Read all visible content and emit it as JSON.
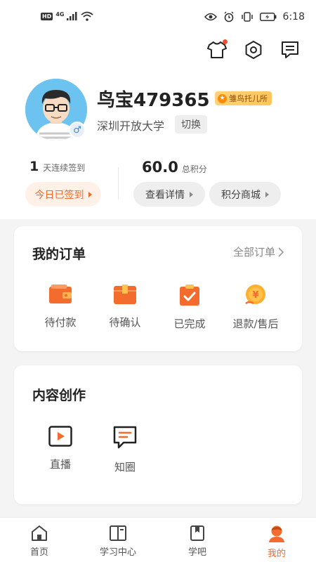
{
  "status_bar": {
    "network_badge": "HD",
    "network_type": "4G",
    "time": "6:18",
    "icons": [
      "signal-icon",
      "wifi-icon",
      "eye-icon",
      "alarm-icon",
      "vibrate-icon",
      "battery-icon"
    ]
  },
  "header": {
    "icons": [
      "shirt-icon",
      "settings-icon",
      "message-icon"
    ],
    "notification_dot_color": "#f0502d"
  },
  "profile": {
    "username": "鸟宝479365",
    "badge": "雏鸟托儿所",
    "school": "深圳开放大学",
    "switch_label": "切换",
    "gender_symbol": "♂"
  },
  "stats": {
    "streak_value": "1",
    "streak_label": "天连续签到",
    "checkin_label": "今日已签到",
    "points_value": "60.0",
    "points_label": "总积分",
    "details_label": "查看详情",
    "mall_label": "积分商城"
  },
  "orders": {
    "title": "我的订单",
    "all_label": "全部订单",
    "items": [
      {
        "label": "待付款",
        "icon": "wallet-icon"
      },
      {
        "label": "待确认",
        "icon": "package-icon"
      },
      {
        "label": "已完成",
        "icon": "clipboard-check-icon"
      },
      {
        "label": "退款/售后",
        "icon": "refund-coin-icon"
      }
    ]
  },
  "creation": {
    "title": "内容创作",
    "items": [
      {
        "label": "直播",
        "icon": "live-play-icon"
      },
      {
        "label": "知圈",
        "icon": "chat-bubble-icon"
      }
    ]
  },
  "tabbar": {
    "tabs": [
      {
        "label": "首页",
        "icon": "home-icon",
        "active": false
      },
      {
        "label": "学习中心",
        "icon": "book-icon",
        "active": false
      },
      {
        "label": "学吧",
        "icon": "bookmark-book-icon",
        "active": false
      },
      {
        "label": "我的",
        "icon": "user-avatar-icon",
        "active": true
      }
    ]
  },
  "colors": {
    "accent": "#f06a2a",
    "page_bg": "#f4f4f5",
    "card_bg": "#ffffff"
  }
}
